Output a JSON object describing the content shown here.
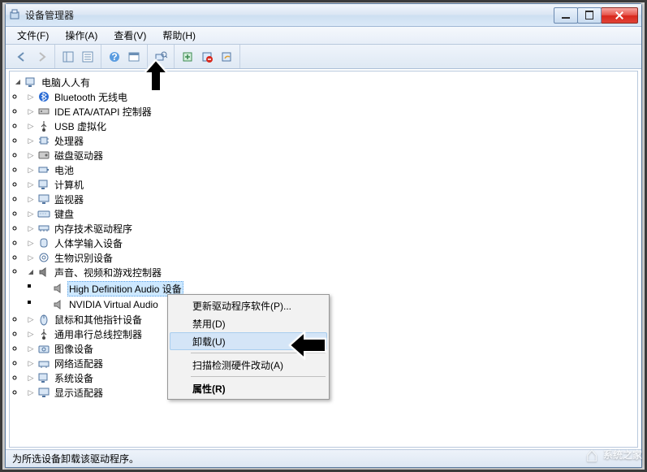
{
  "window": {
    "title": "设备管理器"
  },
  "menu": {
    "file": "文件(F)",
    "action": "操作(A)",
    "view": "查看(V)",
    "help": "帮助(H)"
  },
  "tree": {
    "root": "电脑人人有",
    "bluetooth": "Bluetooth 无线电",
    "ide": "IDE ATA/ATAPI 控制器",
    "usb_virt": "USB 虚拟化",
    "processor": "处理器",
    "disk": "磁盘驱动器",
    "battery": "电池",
    "computer": "计算机",
    "monitor": "监视器",
    "keyboard": "键盘",
    "memory": "内存技术驱动程序",
    "hid": "人体学输入设备",
    "biometric": "生物识别设备",
    "sound": "声音、视频和游戏控制器",
    "sound_hda": "High Definition Audio 设备",
    "sound_nvidia": "NVIDIA Virtual Audio",
    "mouse": "鼠标和其他指针设备",
    "usb_ctrl": "通用串行总线控制器",
    "imaging": "图像设备",
    "network": "网络适配器",
    "system": "系统设备",
    "display": "显示适配器"
  },
  "context": {
    "update": "更新驱动程序软件(P)...",
    "disable": "禁用(D)",
    "uninstall": "卸载(U)",
    "scan": "扫描检测硬件改动(A)",
    "properties": "属性(R)"
  },
  "status": {
    "text": "为所选设备卸载该驱动程序。"
  },
  "watermark": {
    "text": "系统之家"
  }
}
